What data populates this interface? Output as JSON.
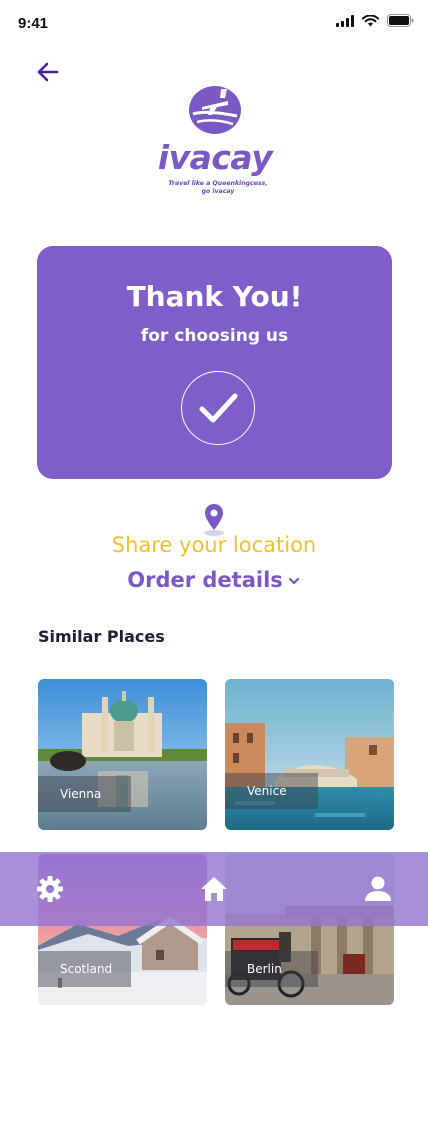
{
  "status": {
    "time": "9:41"
  },
  "brand": {
    "name": "ivacay",
    "tagline_1": "Travel like a Queenkingcess,",
    "tagline_2": "go ivacay"
  },
  "confirmation": {
    "title": "Thank You!",
    "subtitle": "for choosing us"
  },
  "actions": {
    "share_location": "Share your location",
    "order_details": "Order details"
  },
  "similar": {
    "title": "Similar Places",
    "places": [
      {
        "name": "Vienna"
      },
      {
        "name": "Venice"
      },
      {
        "name": "Scotland"
      },
      {
        "name": "Berlin"
      }
    ]
  },
  "colors": {
    "brand_purple": "#7f5ec9",
    "accent_yellow": "#efc130",
    "nav_bar": "#9676d0"
  },
  "icons": {
    "back": "arrow-left-icon",
    "check": "check-icon",
    "location": "location-pin-icon",
    "order_toggle": "chevron-down-icon",
    "nav": [
      "gear-icon",
      "home-icon",
      "user-icon"
    ]
  }
}
